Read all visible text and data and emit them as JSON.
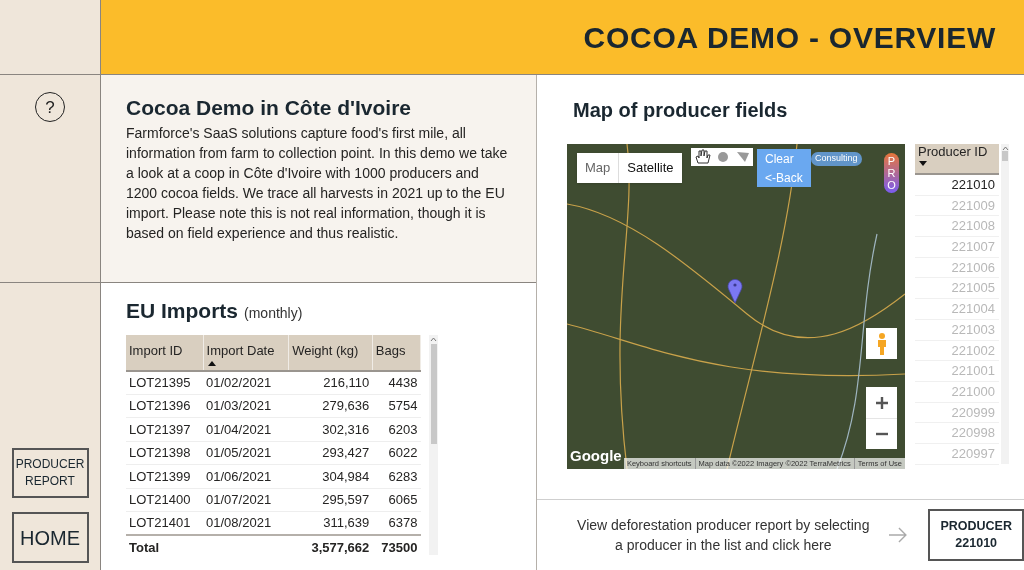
{
  "header": {
    "title": "COCOA DEMO - OVERVIEW"
  },
  "sidebar": {
    "help_label": "?",
    "buttons": [
      {
        "kind": "report",
        "label": "PRODUCER REPORT"
      },
      {
        "kind": "home",
        "label": "HOME"
      }
    ]
  },
  "intro": {
    "title": "Cocoa Demo in Côte d'Ivoire",
    "text": "Farmforce's SaaS solutions capture food's first mile, all information from farm to collection point. In this demo we take a look at a coop in Côte d'Ivoire with 1000 producers and 1200 cocoa fields. We trace all harvests in 2021 up to the EU import. Please note this is not real information, though it is based on field experience and thus realistic."
  },
  "imports": {
    "title": "EU Imports",
    "subtitle": "(monthly)",
    "columns": [
      {
        "label": "Import ID",
        "sorted": false
      },
      {
        "label": "Import Date",
        "sorted": true,
        "ascending": true
      },
      {
        "label": "Weight (kg)",
        "sorted": false
      },
      {
        "label": "Bags",
        "sorted": false
      }
    ],
    "rows": [
      [
        "LOT21395",
        "01/02/2021",
        "216,110",
        "4438"
      ],
      [
        "LOT21396",
        "01/03/2021",
        "279,636",
        "5754"
      ],
      [
        "LOT21397",
        "01/04/2021",
        "302,316",
        "6203"
      ],
      [
        "LOT21398",
        "01/05/2021",
        "293,427",
        "6022"
      ],
      [
        "LOT21399",
        "01/06/2021",
        "304,984",
        "6283"
      ],
      [
        "LOT21400",
        "01/07/2021",
        "295,597",
        "6065"
      ],
      [
        "LOT21401",
        "01/08/2021",
        "311,639",
        "6378"
      ]
    ],
    "total": {
      "label": "Total",
      "weight": "3,577,662",
      "bags": "73500"
    }
  },
  "map": {
    "title": "Map of producer fields",
    "type_buttons": [
      {
        "label": "Map",
        "selected": false
      },
      {
        "label": "Satellite",
        "selected": true
      }
    ],
    "buttons": [
      "Clear",
      "<-Back"
    ],
    "badge": "Consulting",
    "pro_label": "PRO",
    "logo": "Google",
    "footer": [
      "Keyboard shortcuts",
      "Map data ©2022 Imagery ©2022 TerraMetrics",
      "Terms of Use"
    ]
  },
  "producer_list": {
    "column": {
      "label": "Producer ID",
      "sorted": true,
      "ascending": false
    },
    "rows": [
      {
        "id": "221010",
        "selected": true
      },
      {
        "id": "221009",
        "selected": false
      },
      {
        "id": "221008",
        "selected": false
      },
      {
        "id": "221007",
        "selected": false
      },
      {
        "id": "221006",
        "selected": false
      },
      {
        "id": "221005",
        "selected": false
      },
      {
        "id": "221004",
        "selected": false
      },
      {
        "id": "221003",
        "selected": false
      },
      {
        "id": "221002",
        "selected": false
      },
      {
        "id": "221001",
        "selected": false
      },
      {
        "id": "221000",
        "selected": false
      },
      {
        "id": "220999",
        "selected": false
      },
      {
        "id": "220998",
        "selected": false
      },
      {
        "id": "220997",
        "selected": false
      }
    ]
  },
  "report_link": {
    "text": "View deforestation producer report by selecting a producer in the list and click here",
    "button_lines": [
      "PRODUCER",
      "221010"
    ]
  }
}
